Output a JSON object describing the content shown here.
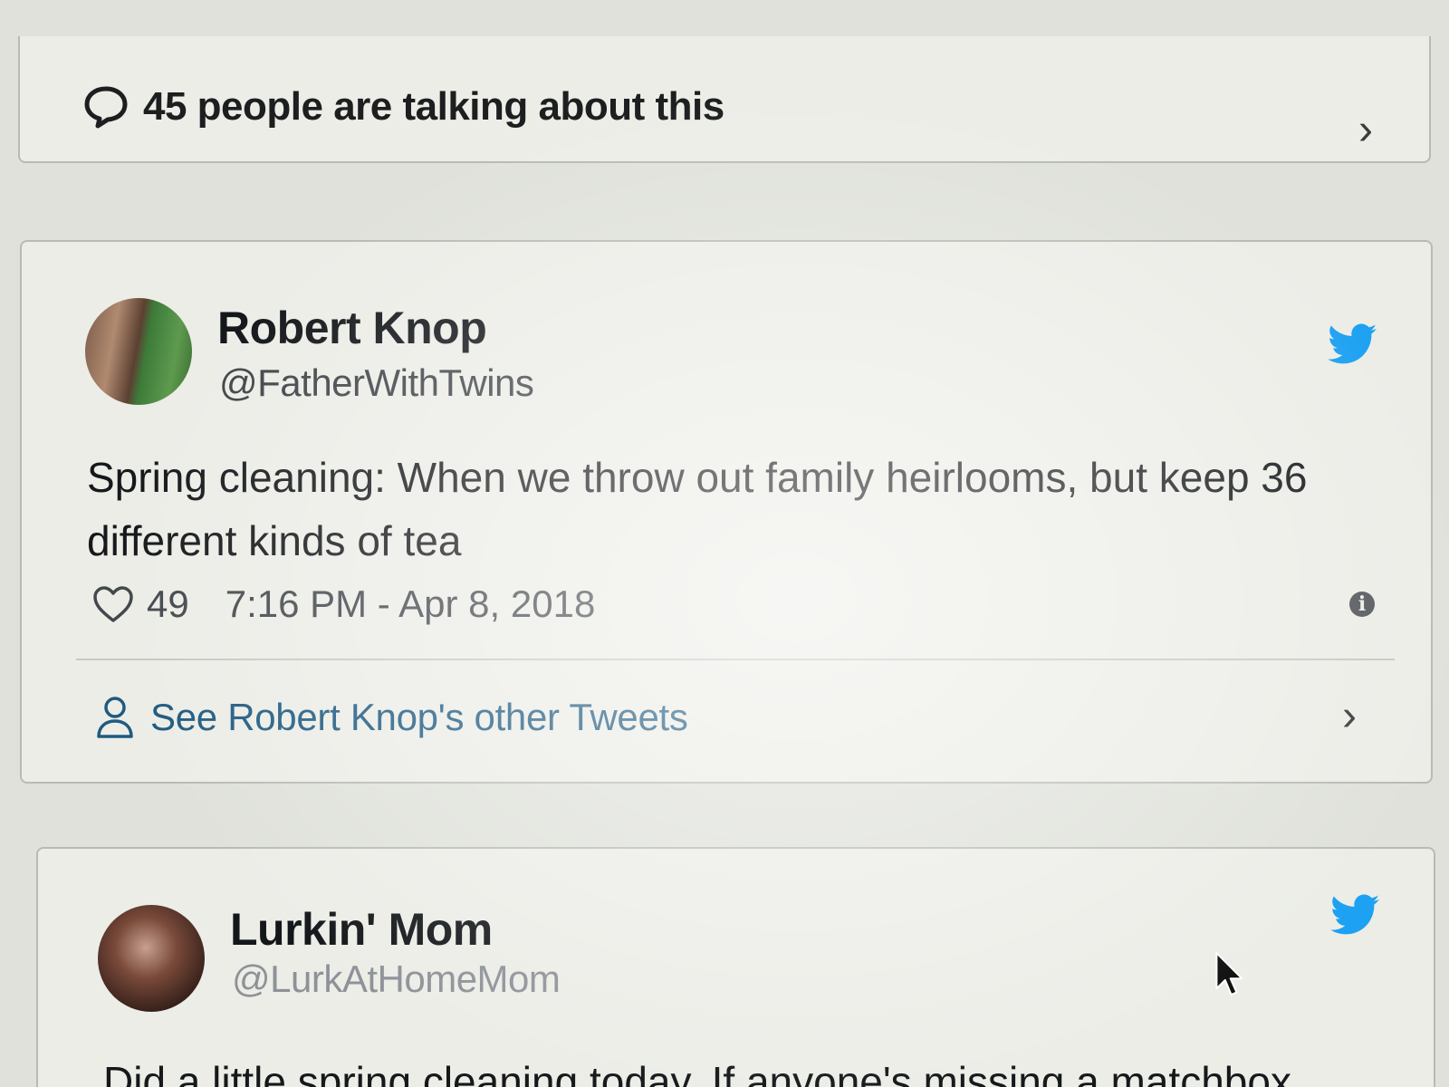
{
  "summary": {
    "text": "45 people are talking about this"
  },
  "tweets": [
    {
      "name": "Robert Knop",
      "handle": "@FatherWithTwins",
      "text": "Spring cleaning: When we throw out family heirlooms, but keep 36 different kinds of tea",
      "likes": "49",
      "timestamp": "7:16 PM - Apr 8, 2018",
      "see_more": "See Robert Knop's other Tweets"
    },
    {
      "name": "Lurkin' Mom",
      "handle": "@LurkAtHomeMom",
      "text": "Did a little spring cleaning today. If anyone's missing a matchbox"
    }
  ],
  "icons": {
    "comment": "speech-bubble-icon",
    "chevron": "chevron-right-icon",
    "bird": "twitter-bird-icon",
    "heart": "heart-icon",
    "info": "info-icon",
    "person": "person-icon",
    "cursor": "mouse-pointer-icon"
  },
  "colors": {
    "twitter_blue": "#1da1f2",
    "link_blue": "#1f5a80",
    "background": "#dfe1da"
  }
}
